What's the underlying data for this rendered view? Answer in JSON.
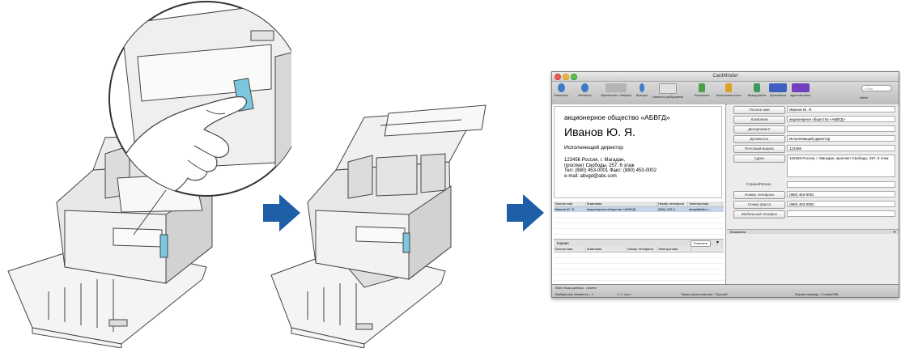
{
  "cardminder": {
    "window_title": "CardMinder",
    "search_placeholder": "Все",
    "toolbar": [
      {
        "label": "Уменьшить",
        "color": "#3a7cc7"
      },
      {
        "label": "Увеличить",
        "color": "#3a7cc7"
      },
      {
        "label": "Переместить / Выбрать",
        "color": "#9a9a9a"
      },
      {
        "label": "Вращать",
        "color": "#5a5a5a"
      },
      {
        "label": "Изменить изображение",
        "color": "#3a7cc7"
      },
      {
        "label": "Распознать",
        "color": "#e0e0e0"
      },
      {
        "label": "Электронная почта",
        "color": "#4aa04a"
      },
      {
        "label": "Вывод файла",
        "color": "#e0a020"
      },
      {
        "label": "Приложение",
        "color": "#3b9c5a"
      },
      {
        "label": "Адресная книга",
        "color": "#4060c0"
      },
      {
        "label": "Найти",
        "color": "#7040c0"
      }
    ],
    "card": {
      "company": "акционерное общество «АБВГД»",
      "name": "Иванов Ю. Я.",
      "title": "Исполняющий директор",
      "address_line1": "123456 Россия, г. Магадан,",
      "address_line2": "проспект Свободы, 257, 6 этаж",
      "phone_line": "Тел: (880) 453-0001     Факс: (880) 453-0002",
      "email_line": "e-mail: abvgd@abc.com"
    },
    "list": {
      "headers": [
        "Полное имя",
        "Компания",
        "Номер телефона",
        "Электронная"
      ],
      "rows": [
        [
          "Иванов Ю. Я.",
          "акционерное общество «АБВГД»",
          "(880) 453-0...",
          "abvgd@abc.c..."
        ]
      ]
    },
    "basket": {
      "label": "Корзин",
      "clear_button": "Очистить",
      "headers": [
        "Полное имя",
        "Компания",
        "Номер телефона",
        "Электронная"
      ]
    },
    "fields": [
      {
        "label": "Полное имя",
        "value": "Иванов Ю. Я."
      },
      {
        "label": "Компания",
        "value": "акционерное общество «АБВГД»"
      },
      {
        "label": "Департамент",
        "value": ""
      },
      {
        "label": "Должность",
        "value": "Исполняющий директор"
      },
      {
        "label": "Почтовый индекс",
        "value": "123456"
      },
      {
        "label": "Адрес",
        "value": "123456 Россия, г. Магадан, проспект Свободы, 257, 6 этаж"
      },
      {
        "label": "Страна/Регион",
        "value": ""
      },
      {
        "label": "Номер телефона",
        "value": "(880) 453-0001"
      },
      {
        "label": "Номер факса",
        "value": "(880) 453-0002"
      },
      {
        "label": "Мобильный телефон",
        "value": ""
      }
    ],
    "attachments_label": "Вложения",
    "status": {
      "db_file": "Файл базы данных : /Users/",
      "selected": "Выбранные элементы : 1",
      "pages": "1 / 1 лист",
      "location": "Ваше расположение : Русский",
      "output_format": "Формат вывода : ContactXML"
    }
  },
  "colors": {
    "arrow": "#1f5fa8",
    "button_highlight": "#7cc7e0"
  }
}
